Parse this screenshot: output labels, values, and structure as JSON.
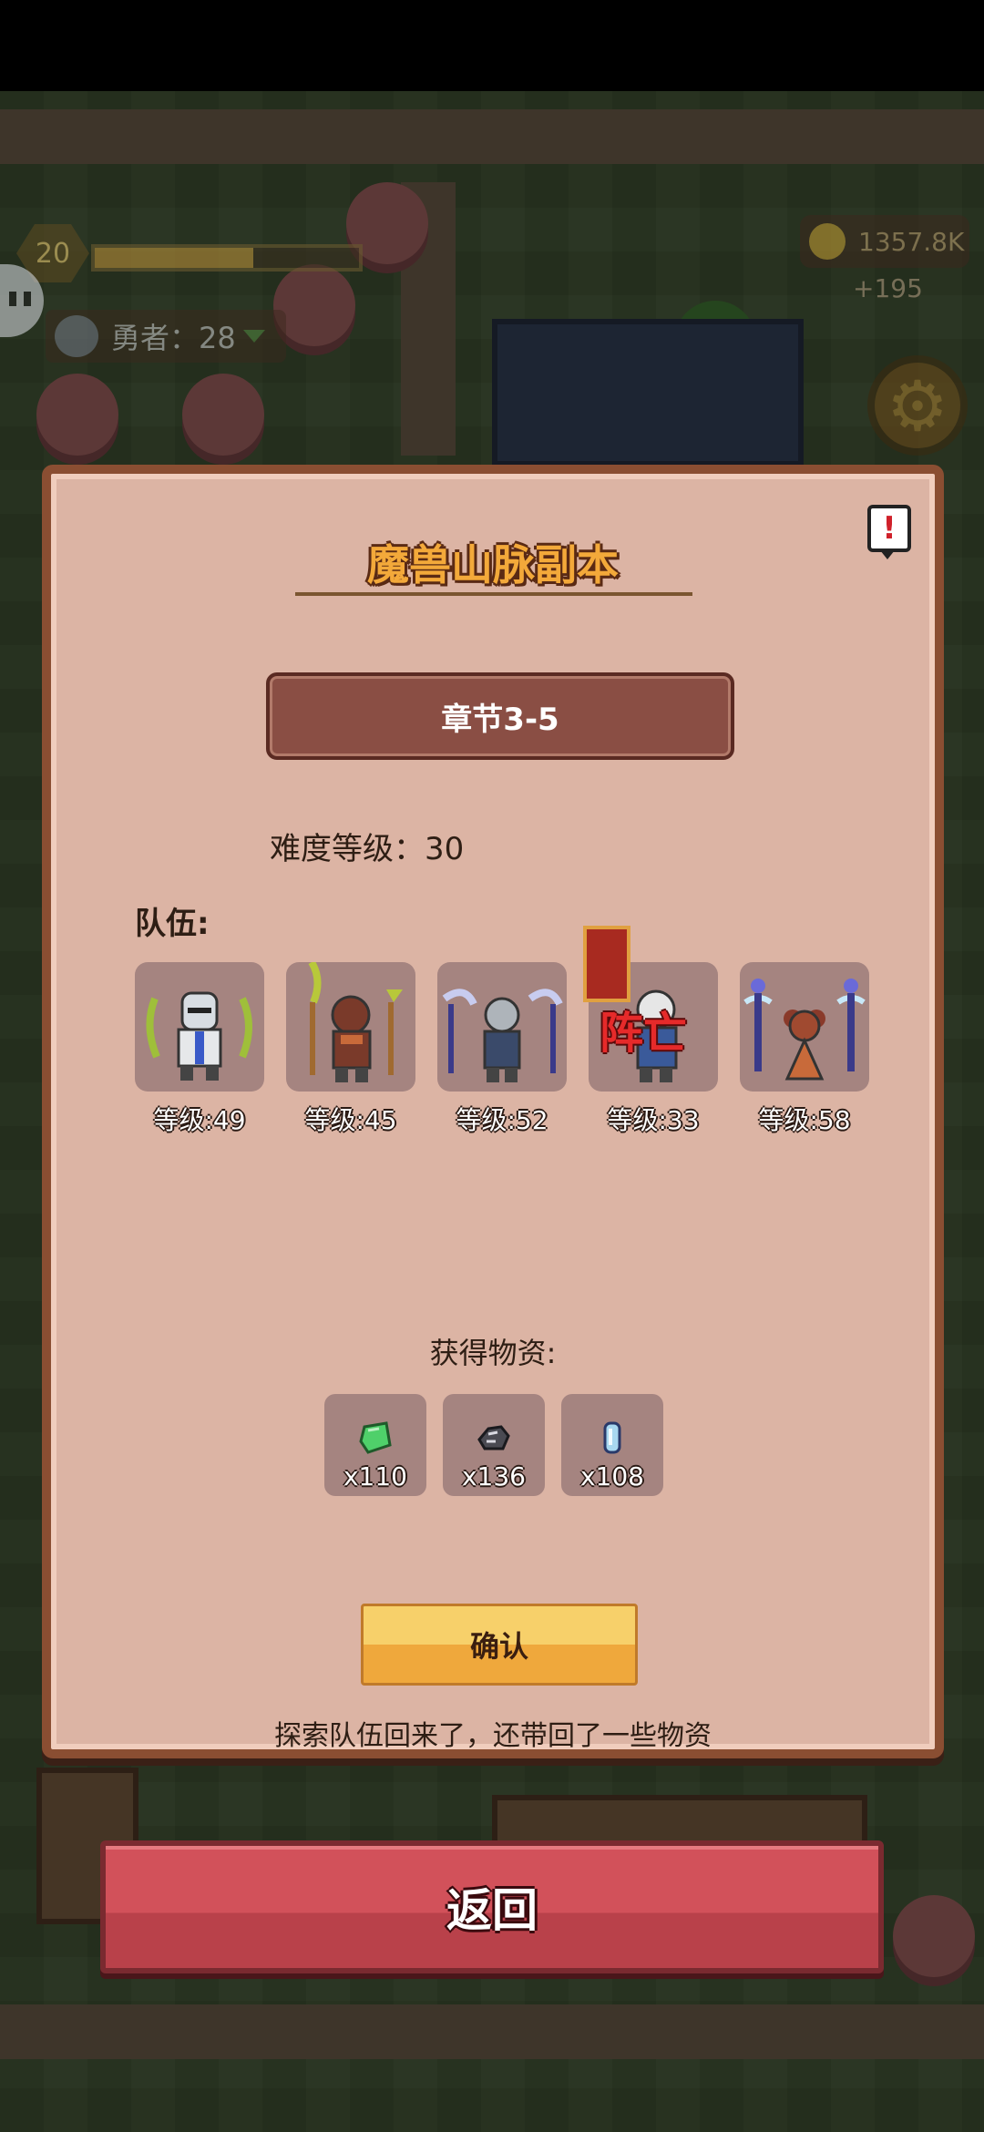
{
  "hud": {
    "player_level": "20",
    "exp_fill_fraction": 0.6,
    "heroes_label": "勇者：28",
    "gold": "1357.8K",
    "gold_gain": "+195"
  },
  "dialog": {
    "title": "魔兽山脉副本",
    "chapter": "章节3-5",
    "difficulty": "难度等级：30",
    "team_label": "队伍:",
    "team": [
      {
        "level_label": "等级:49",
        "status": "",
        "weapon_color": "#9fbf3a",
        "body_color": "#d8dde2"
      },
      {
        "level_label": "等级:45",
        "status": "",
        "weapon_color": "#b8c83a",
        "body_color": "#7a3a2a"
      },
      {
        "level_label": "等级:52",
        "status": "",
        "weapon_color": "#c8ccf0",
        "body_color": "#3a4a6a"
      },
      {
        "level_label": "等级:33",
        "status": "阵亡",
        "weapon_color": "#c83a2a",
        "body_color": "#3a5a9a"
      },
      {
        "level_label": "等级:58",
        "status": "",
        "weapon_color": "#6a6ad8",
        "body_color": "#c86a3a"
      }
    ],
    "rewards_label": "获得物资:",
    "rewards": [
      {
        "icon": "green-gem-icon",
        "count": "x110",
        "color": "#4fd06a"
      },
      {
        "icon": "iron-ore-icon",
        "count": "x136",
        "color": "#4a4a52"
      },
      {
        "icon": "crystal-icon",
        "count": "x108",
        "color": "#a8d8f0"
      }
    ],
    "confirm_label": "确认",
    "footer_message": "探索队伍回来了，还带回了一些物资"
  },
  "back_button_label": "返回",
  "colors": {
    "dialog_bg": "#dcb4a4",
    "dialog_border": "#8a4e32",
    "title": "#f3a93a",
    "confirm": "#efa83c",
    "back": "#c8474f"
  }
}
